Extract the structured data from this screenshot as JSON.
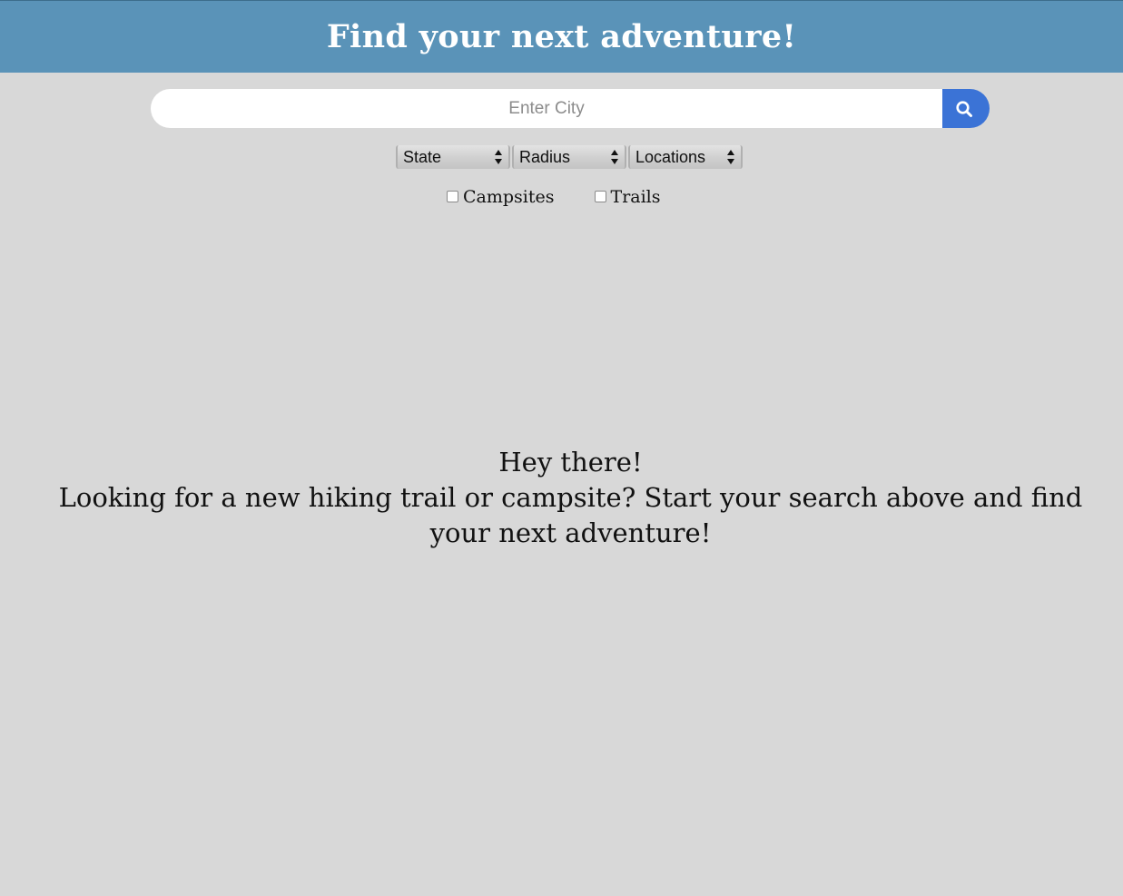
{
  "header": {
    "title": "Find your next adventure!"
  },
  "search": {
    "placeholder": "Enter City",
    "button_icon": "search-icon"
  },
  "filters": {
    "state_label": "State",
    "radius_label": "Radius",
    "locations_label": "Locations"
  },
  "checkboxes": {
    "campsites_label": "Campsites",
    "campsites_checked": false,
    "trails_label": "Trails",
    "trails_checked": false
  },
  "welcome": {
    "greeting": "Hey there!",
    "message": "Looking for a new hiking trail or campsite? Start your search above and find your next adventure!"
  },
  "colors": {
    "header_bg": "#5a93b8",
    "page_bg": "#d8d8d8",
    "search_button": "#3b73d6"
  }
}
